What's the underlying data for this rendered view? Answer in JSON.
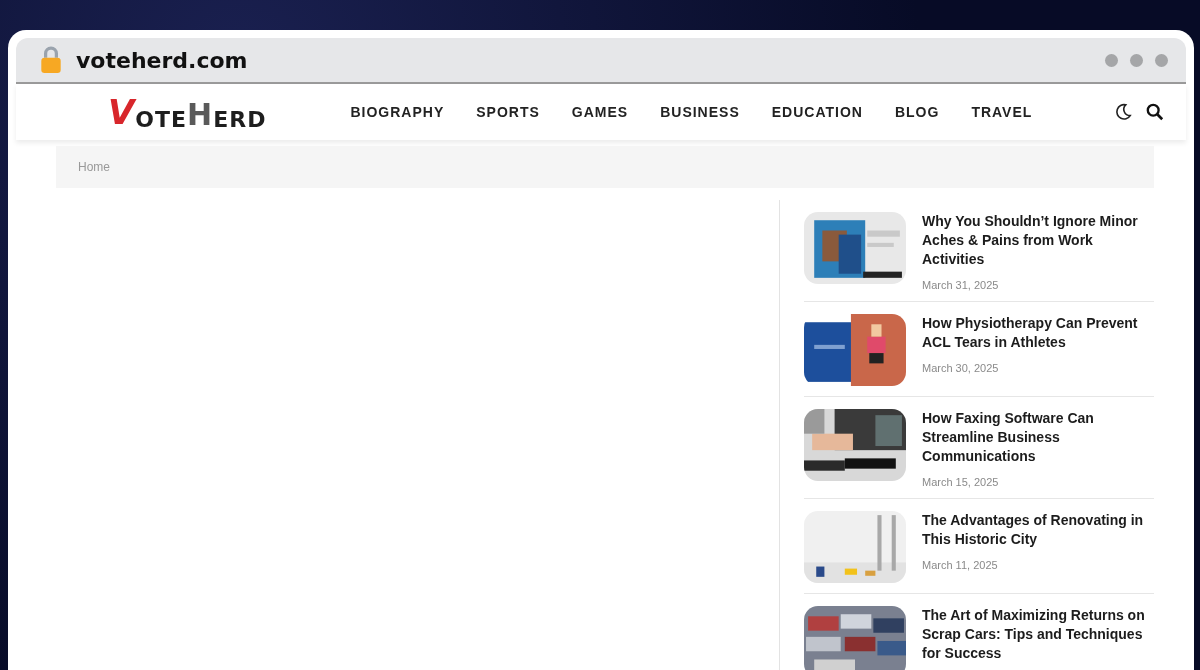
{
  "browser": {
    "url": "voteherd.com"
  },
  "logo": "VOTEHERD",
  "nav": [
    "BIOGRAPHY",
    "SPORTS",
    "GAMES",
    "BUSINESS",
    "EDUCATION",
    "BLOG",
    "TRAVEL"
  ],
  "breadcrumb": [
    "Home"
  ],
  "sidebar_posts": [
    {
      "title": "Why You Shouldn’t Ignore Minor Aches & Pains from Work Activities",
      "date": "March 31, 2025",
      "kind": "picture"
    },
    {
      "title": "How Physiotherapy Can Prevent ACL Tears in Athletes",
      "date": "March 30, 2025",
      "kind": "picture"
    },
    {
      "title": "How Faxing Software Can Streamline Business Communications",
      "date": "March 15, 2025",
      "kind": "picture"
    },
    {
      "title": "The Advantages of Renovating in This Historic City",
      "date": "March 11, 2025",
      "kind": "picture"
    },
    {
      "title": "The Art of Maximizing Returns on Scrap Cars: Tips and Techniques for Success",
      "kind": "picture"
    }
  ]
}
